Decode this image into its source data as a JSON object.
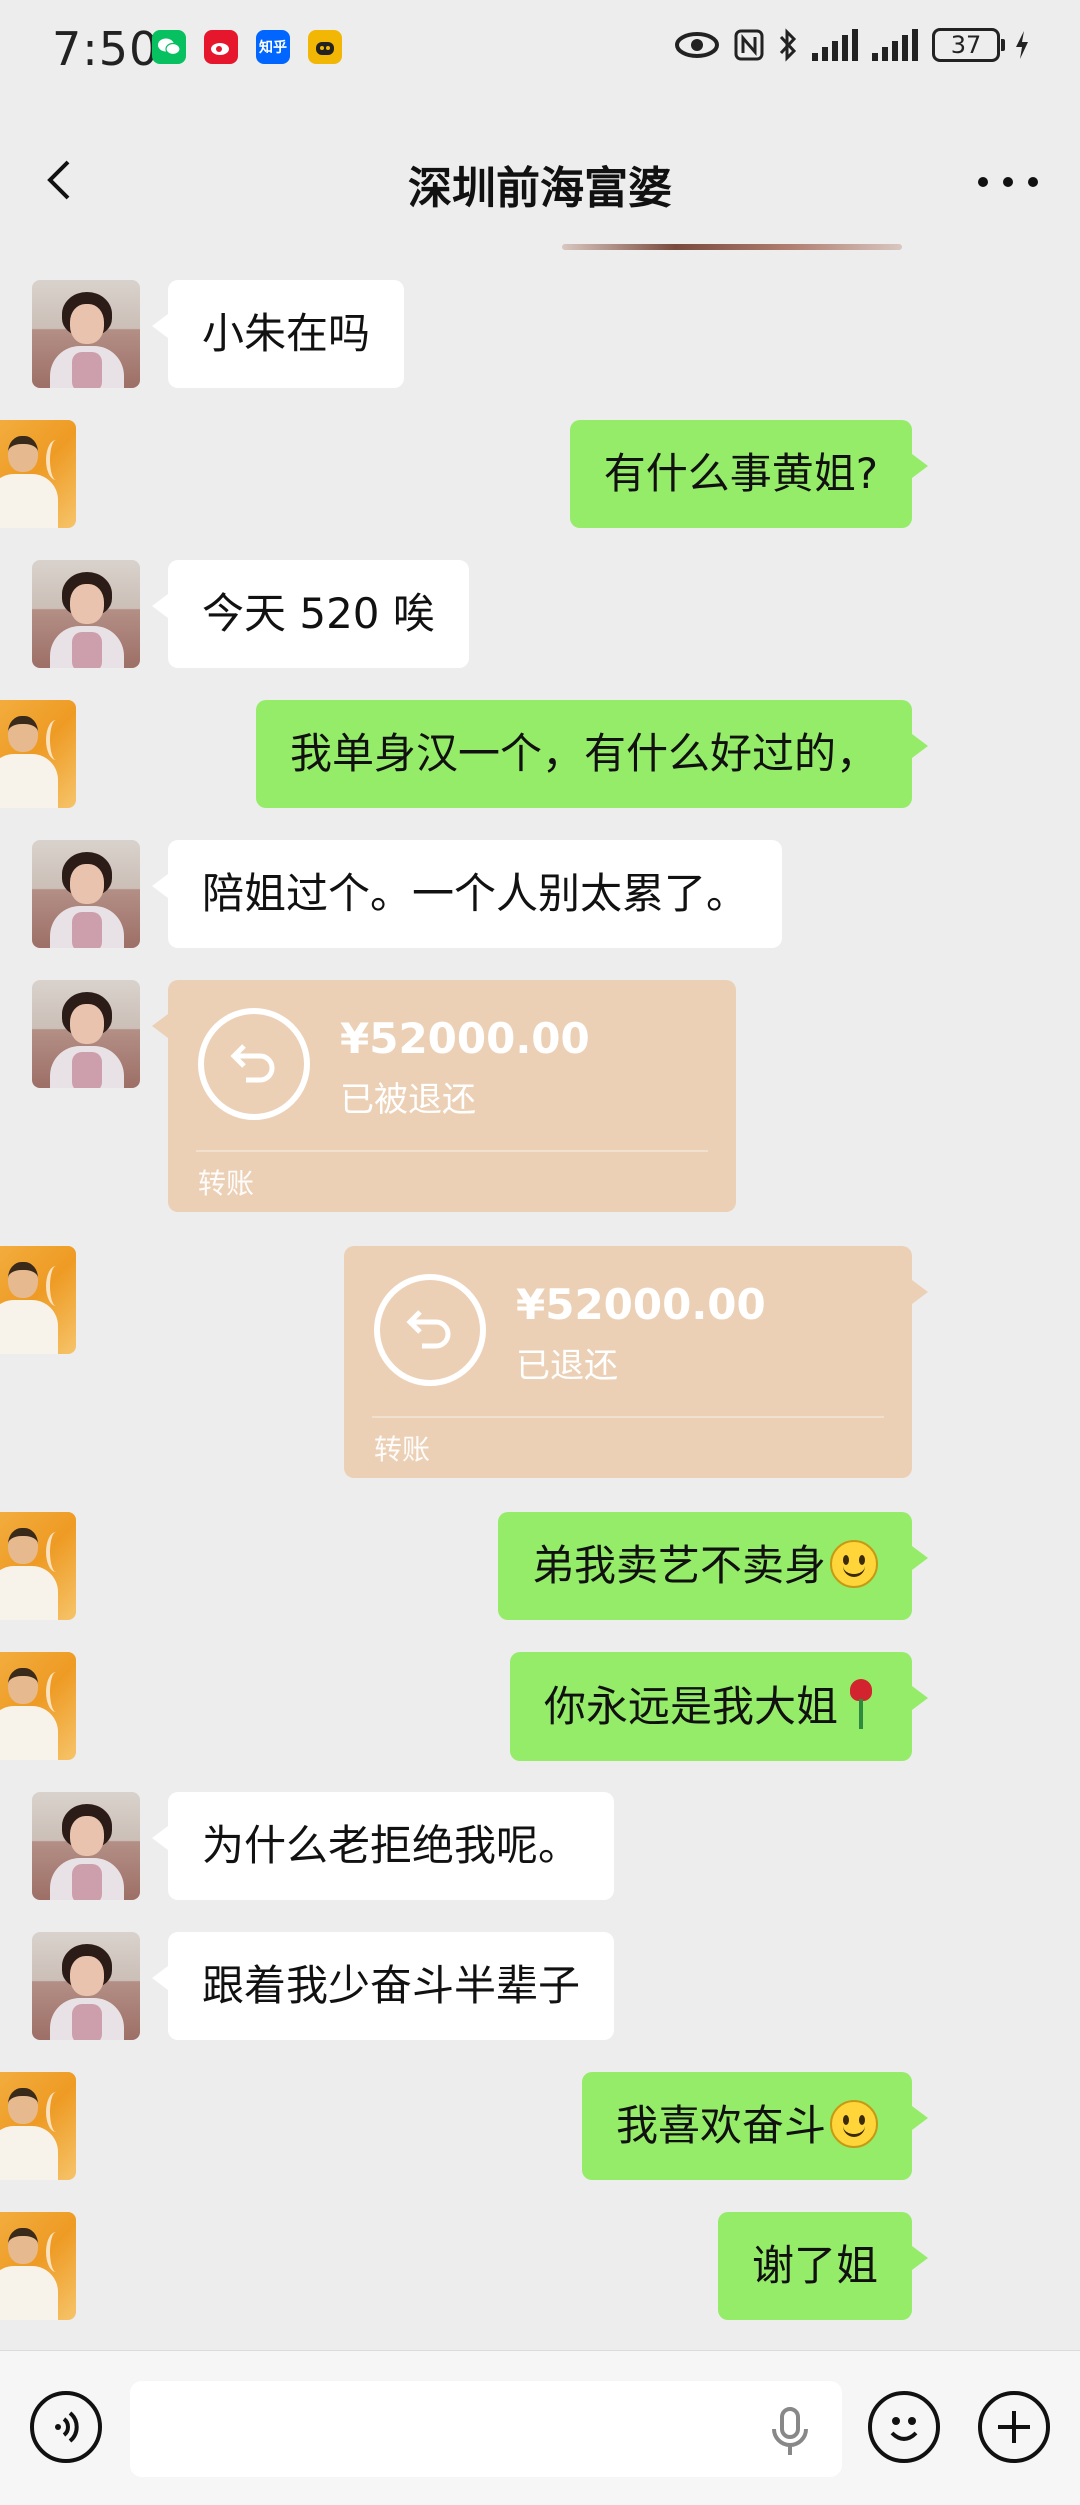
{
  "status_bar": {
    "time": "7:50",
    "battery": "37",
    "apps": [
      {
        "name": "wechat-icon",
        "color": "#07c160"
      },
      {
        "name": "weibo-icon",
        "color": "#e6162d"
      },
      {
        "name": "zhihu-icon",
        "color": "#0066ff",
        "text": "知乎"
      },
      {
        "name": "cat-app-icon",
        "color": "#f2b705"
      }
    ]
  },
  "header": {
    "title": "深圳前海富婆"
  },
  "messages": [
    {
      "from": "her",
      "text": "小朱在吗"
    },
    {
      "from": "me",
      "text": "有什么事黄姐?"
    },
    {
      "from": "her",
      "text": "今天 520 唉"
    },
    {
      "from": "me",
      "text": "我单身汉一个，有什么好过的，"
    },
    {
      "from": "her",
      "text": "陪姐过个。一个人别太累了。"
    },
    {
      "from": "her",
      "type": "transfer",
      "amount": "¥52000.00",
      "status": "已被退还",
      "label": "转账"
    },
    {
      "from": "me",
      "type": "transfer",
      "amount": "¥52000.00",
      "status": "已退还",
      "label": "转账"
    },
    {
      "from": "me",
      "text": "弟我卖艺不卖身",
      "emoji": "smile-emoji"
    },
    {
      "from": "me",
      "text": "你永远是我大姐",
      "emoji": "rose-emoji"
    },
    {
      "from": "her",
      "text": "为什么老拒绝我呢。"
    },
    {
      "from": "her",
      "text": "跟着我少奋斗半辈子"
    },
    {
      "from": "me",
      "text": "我喜欢奋斗",
      "emoji": "smile-emoji"
    },
    {
      "from": "me",
      "text": "谢了姐"
    }
  ],
  "colors": {
    "background": "#ededed",
    "my_bubble": "#95ec69",
    "her_bubble": "#ffffff",
    "transfer": "#ecd0b6"
  }
}
